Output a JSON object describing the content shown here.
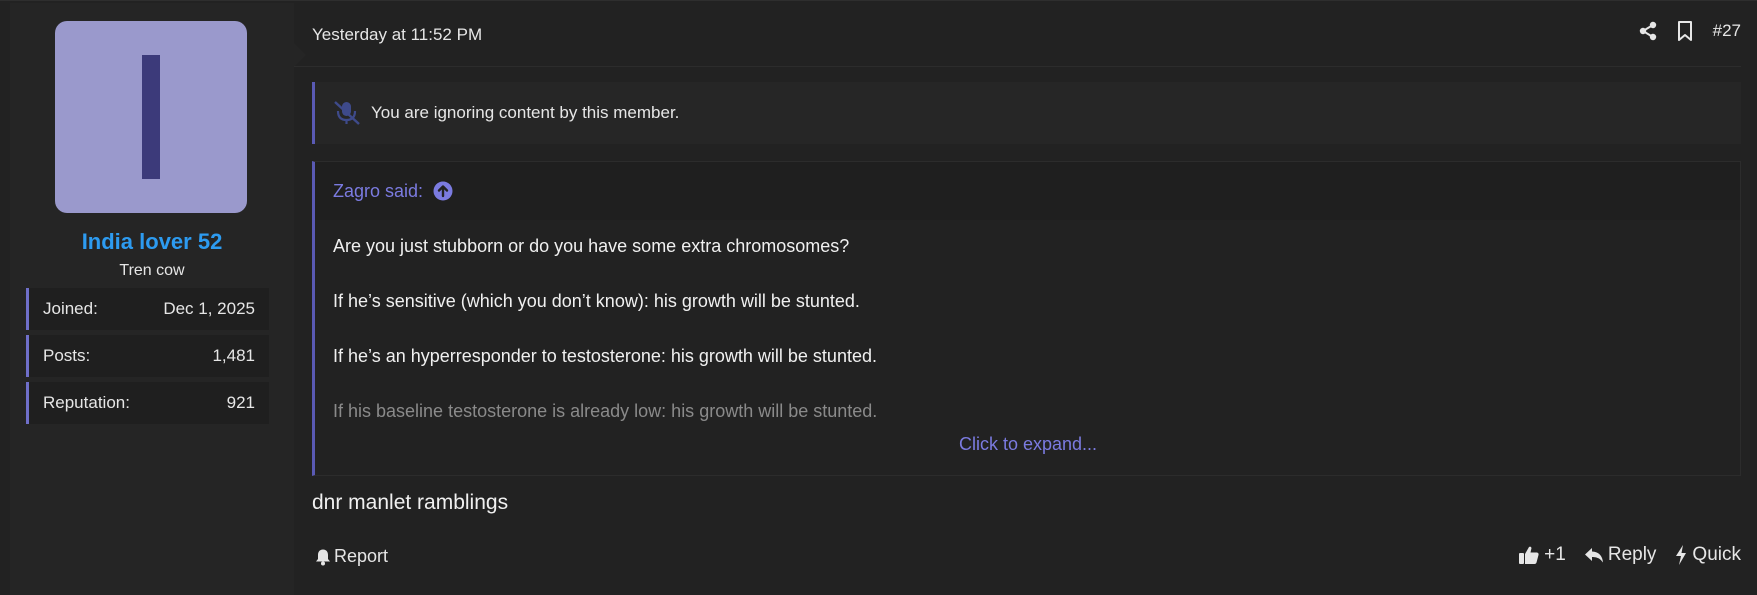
{
  "user": {
    "avatar_letter": "I",
    "avatar_bg": "#9a99cc",
    "name": "India lover 52",
    "name_color": "#2d9bf0",
    "title": "Tren cow",
    "stats": [
      {
        "label": "Joined:",
        "value": "Dec 1, 2025"
      },
      {
        "label": "Posts:",
        "value": "1,481"
      },
      {
        "label": "Reputation:",
        "value": "921"
      }
    ]
  },
  "header": {
    "timestamp": "Yesterday at 11:52 PM",
    "share_icon": "share-icon",
    "bookmark_icon": "bookmark-icon",
    "post_number": "#27"
  },
  "ignored_notice": {
    "icon": "muted-microphone-icon",
    "text": "You are ignoring content by this member."
  },
  "quote": {
    "author": "Zagro said:",
    "lines": [
      "Are you just stubborn or do you have some extra chromosomes?",
      "If he’s sensitive (which you don’t know): his growth will be stunted.",
      "If he’s an hyperresponder to testosterone: his growth will be stunted.",
      "If his baseline testosterone is already low: his growth will be stunted."
    ],
    "expand_label": "Click to expand..."
  },
  "message": "dnr manlet ramblings",
  "footer": {
    "report_label": "Report",
    "like_label": "+1",
    "reply_label": "Reply",
    "quick_label": "Quick"
  },
  "colors": {
    "accent": "#5a5ab4",
    "link": "#7b7be0",
    "background": "#222222"
  }
}
